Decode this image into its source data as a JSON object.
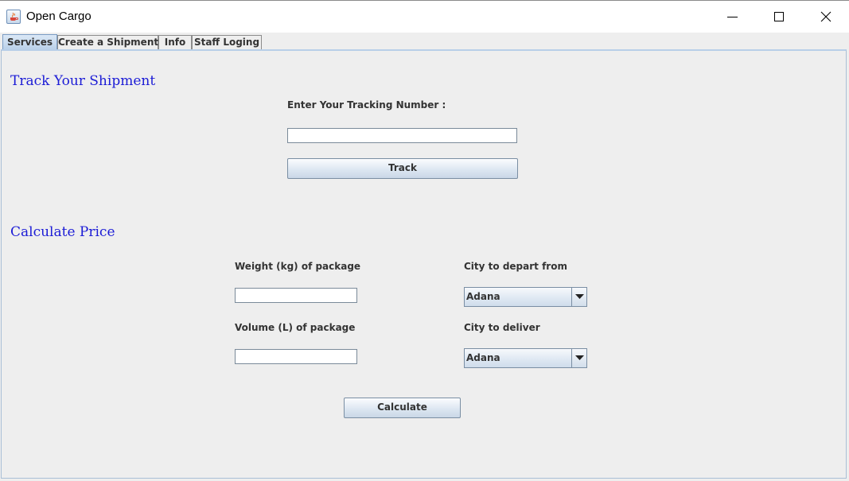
{
  "window": {
    "title": "Open Cargo"
  },
  "tabs": [
    {
      "label": "Services",
      "selected": true
    },
    {
      "label": "Create a Shipment",
      "selected": false
    },
    {
      "label": "Info",
      "selected": false
    },
    {
      "label": "Staff Loging",
      "selected": false
    }
  ],
  "track": {
    "title": "Track Your Shipment",
    "tracking_label": "Enter Your Tracking Number :",
    "tracking_value": "",
    "button_label": "Track"
  },
  "price": {
    "title": "Calculate Price",
    "weight_label": "Weight (kg) of package",
    "weight_value": "",
    "volume_label": "Volume (L) of package",
    "volume_value": "",
    "depart_label": "City to depart from",
    "depart_value": "Adana",
    "deliver_label": "City to deliver",
    "deliver_value": "Adana",
    "button_label": "Calculate"
  },
  "icons": {
    "app": "java-cup-icon",
    "minimize": "minimize-icon",
    "maximize": "maximize-icon",
    "close": "close-icon",
    "dropdown": "triangle-down-icon"
  },
  "colors": {
    "section_title": "#1c1cd6",
    "selected_tab": "#b8cfe8",
    "panel_background": "#eeeeee"
  }
}
